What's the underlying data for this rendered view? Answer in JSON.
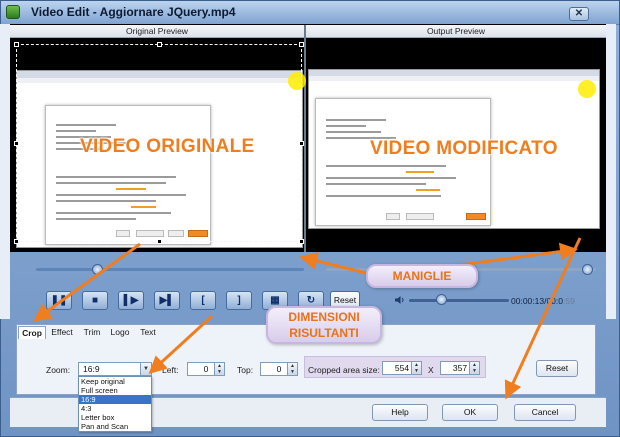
{
  "window": {
    "title": "Video Edit - Aggiornare JQuery.mp4",
    "close_label": "✕"
  },
  "preview": {
    "original_header": "Original Preview",
    "output_header": "Output Preview",
    "original_label": "VIDEO ORIGINALE",
    "output_label": "VIDEO MODIFICATO"
  },
  "playback": {
    "time_display": "00:00:13/00:0",
    "time_tail": ":59",
    "reset_label": "Reset"
  },
  "tabs": [
    {
      "label": "Crop",
      "active": true
    },
    {
      "label": "Effect",
      "active": false
    },
    {
      "label": "Trim",
      "active": false
    },
    {
      "label": "Logo",
      "active": false
    },
    {
      "label": "Text",
      "active": false
    }
  ],
  "crop": {
    "zoom_label": "Zoom:",
    "zoom_value": "16:9",
    "left_label": "Left:",
    "left_value": "0",
    "top_label": "Top:",
    "top_value": "0",
    "cropped_size_label": "Cropped area size:",
    "width_value": "554",
    "x_separator": "X",
    "height_value": "357",
    "reset_label": "Reset",
    "zoom_options": [
      "Keep original",
      "Full screen",
      "16:9",
      "4:3",
      "Letter box",
      "Pan and Scan"
    ],
    "zoom_selected": "16:9"
  },
  "footer": {
    "help_label": "Help",
    "ok_label": "OK",
    "cancel_label": "Cancel"
  },
  "annotations": {
    "handles_callout": "MANIGLIE",
    "dimensions_callout": "DIMENSIONI\nRISULTANTI"
  },
  "colors": {
    "annotation_orange": "#f07d1e",
    "callout_bg": "#e3dbf0",
    "selection_blue": "#3b73c8"
  },
  "icons": [
    "video-app-icon",
    "play-icon",
    "stop-icon",
    "next-frame-icon",
    "bracket-left-icon",
    "bracket-right-icon",
    "snapshot-icon",
    "rotate-icon",
    "speaker-icon"
  ]
}
